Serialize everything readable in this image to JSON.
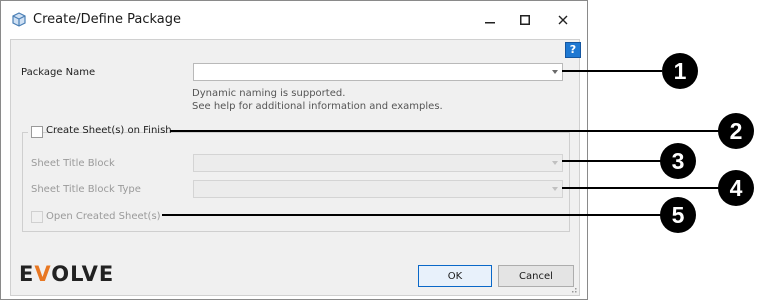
{
  "window": {
    "title": "Create/Define Package"
  },
  "help": {
    "label": "?"
  },
  "package_name": {
    "label": "Package Name",
    "value": "",
    "hint_line1": "Dynamic naming is supported.",
    "hint_line2": "See help for additional information and examples."
  },
  "create_sheets": {
    "label": "Create Sheet(s) on Finish",
    "checked": false
  },
  "sheet_title_block": {
    "label": "Sheet Title Block",
    "value": "",
    "enabled": false
  },
  "sheet_title_block_type": {
    "label": "Sheet Title Block Type",
    "value": "",
    "enabled": false
  },
  "open_created_sheets": {
    "label": "Open Created Sheet(s)",
    "checked": false,
    "enabled": false
  },
  "buttons": {
    "ok": "OK",
    "cancel": "Cancel"
  },
  "logo": {
    "part1": "E",
    "part2": "V",
    "part3": "OLVE",
    "accent_color": "#e87722"
  },
  "callouts": [
    "1",
    "2",
    "3",
    "4",
    "5"
  ]
}
